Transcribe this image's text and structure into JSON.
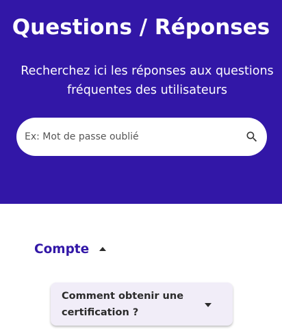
{
  "hero": {
    "title": "Questions / Réponses",
    "subtitle": "Recherchez ici les réponses aux questions fréquentes des utilisateurs"
  },
  "search": {
    "placeholder": "Ex: Mot de passe oublié",
    "value": "",
    "icon": "search-icon"
  },
  "section": {
    "label": "Compte",
    "expanded": true,
    "icon": "caret-up-icon"
  },
  "faq": {
    "items": [
      {
        "question": "Comment obtenir une certification ?",
        "expanded": false,
        "icon": "caret-down-icon"
      }
    ]
  },
  "colors": {
    "primary": "#3217a7",
    "card_background": "#f1edf8",
    "text_dark": "#2b2b2b",
    "white": "#ffffff"
  }
}
